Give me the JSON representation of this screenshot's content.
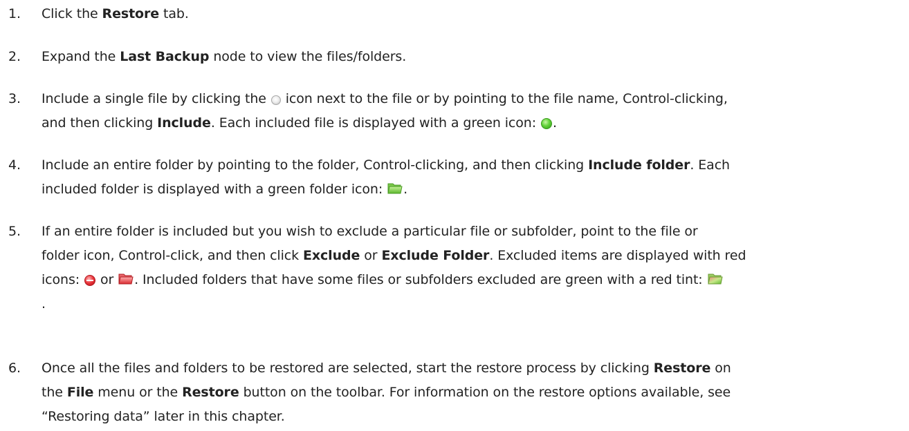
{
  "icons": {
    "include_single": "unselected-circle-icon",
    "included_file": "green-circle-icon",
    "included_folder": "green-folder-icon",
    "excluded_file": "red-circle-icon",
    "excluded_folder": "red-folder-icon",
    "partial_folder": "green-red-tint-folder-icon"
  },
  "colors": {
    "included": "#4cc12a",
    "excluded": "#e0242c",
    "unselected": "#cccccc"
  },
  "steps": [
    {
      "num": "1.",
      "t1": "Click the ",
      "b1": "Restore",
      "t2": " tab."
    },
    {
      "num": "2.",
      "t1": "Expand the ",
      "b1": "Last Backup",
      "t2": " node to view the files/folders."
    },
    {
      "num": "3.",
      "t1": "Include a single file by clicking the ",
      "t2": " icon next to the file or by pointing to the file name, Control-clicking,",
      "t3": "and then clicking ",
      "b1": "Include",
      "t4": ".  Each included file is displayed with a green icon: ",
      "t5": "."
    },
    {
      "num": "4.",
      "t1": "Include an entire folder by pointing to the folder, Control-clicking, and then clicking ",
      "b1": "Include folder",
      "t2": ".  Each",
      "t3": "included folder is displayed with a green folder icon: ",
      "t4": "."
    },
    {
      "num": "5.",
      "t1": "If an entire folder is included but you wish to exclude a particular file or subfolder, point to the file or",
      "t2": "folder icon, Control-click, and then click ",
      "b1": "Exclude",
      "t3": " or ",
      "b2": "Exclude Folder",
      "t4": ". Excluded items are displayed with red",
      "t5": "icons: ",
      "t6": " or ",
      "t7": ". Included folders that have some files or subfolders excluded are green with a red tint: ",
      "t8": "."
    },
    {
      "num": "6.",
      "t1": "Once all the files and folders to be restored are selected, start the restore process by clicking ",
      "b1": "Restore",
      "t2": " on",
      "t3": "the ",
      "b2": "File",
      "t4": " menu or the ",
      "b3": "Restore",
      "t5": " button on the toolbar. For information on the restore options available, see",
      "t6": "“Restoring data” later in this chapter."
    }
  ]
}
